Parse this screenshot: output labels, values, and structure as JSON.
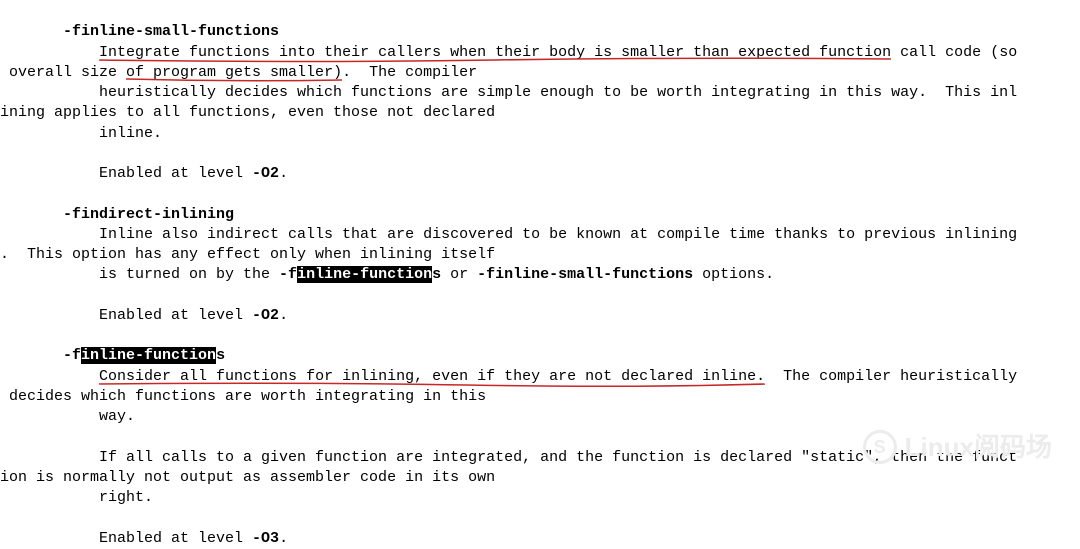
{
  "opt1": {
    "name": "-finline-small-functions",
    "desc_u": "Integrate functions into their callers when their body is smaller than expected function",
    "desc_tail1": " call code (so",
    "wrap1a": " overall size ",
    "wrap1b_u": "of program gets smaller)",
    "wrap1c": ".  The compiler",
    "line2": "           heuristically decides which functions are simple enough to be worth integrating in this way.  This inl",
    "line3": "ining applies to all functions, even those not declared",
    "line4": "           inline.",
    "enabled_pre": "           Enabled at level ",
    "enabled_lvl": "-O2",
    "enabled_suf": "."
  },
  "opt2": {
    "name": "-findirect-inlining",
    "line1": "           Inline also indirect calls that are discovered to be known at compile time thanks to previous inlining",
    "line2": ".  This option has any effect only when inlining itself",
    "line3_pre": "           is turned on by the ",
    "line3_f1a": "-f",
    "line3_f1b": "inline-function",
    "line3_f1c": "s",
    "line3_mid": " or ",
    "line3_f2": "-finline-small-functions",
    "line3_suf": " options.",
    "enabled_pre": "           Enabled at level ",
    "enabled_lvl": "-O2",
    "enabled_suf": "."
  },
  "opt3": {
    "name_a": "-f",
    "name_b": "inline-function",
    "name_c": "s",
    "desc_u": "Consider all functions for inlining, even if they are not declared inline.",
    "desc_tail": "  The compiler heuristically",
    "line2": " decides which functions are worth integrating in this",
    "line3": "           way.",
    "p2_l1": "           If all calls to a given function are integrated, and the function is declared \"static\", then the funct",
    "p2_l2": "ion is normally not output as assembler code in its own",
    "p2_l3": "           right.",
    "enabled_pre": "           Enabled at level ",
    "enabled_lvl": "-O3",
    "enabled_suf": "."
  },
  "watermark": {
    "icon_letter": "S",
    "text": "Linux阅码场"
  }
}
